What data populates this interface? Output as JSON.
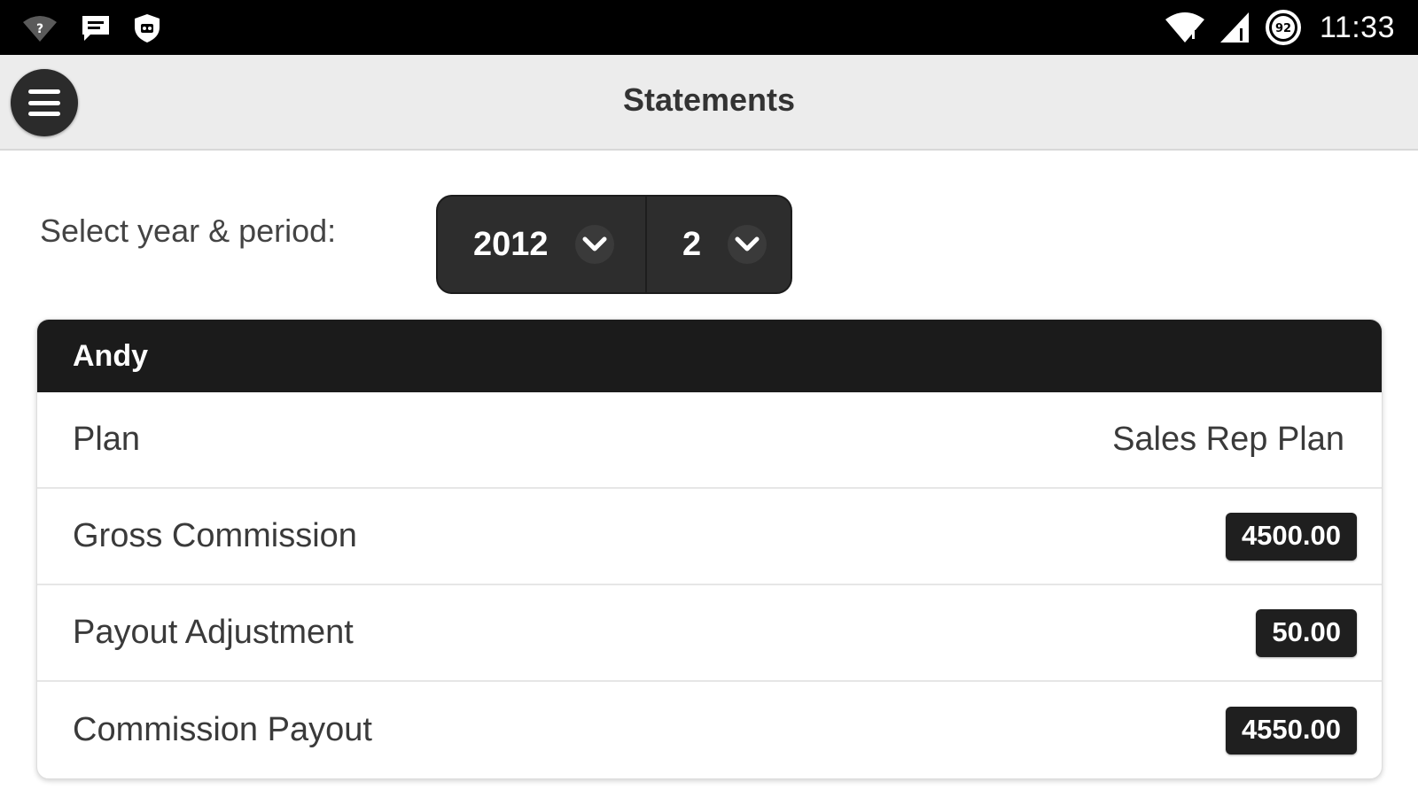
{
  "status_bar": {
    "time": "11:33",
    "left_icons": [
      "wifi-question-icon",
      "message-icon",
      "shield-icon"
    ],
    "right_icons": [
      "wifi-icon",
      "cell-signal-icon",
      "battery-icon"
    ],
    "battery_level": "92"
  },
  "header": {
    "title": "Statements",
    "menu_icon": "hamburger-menu-icon"
  },
  "selector": {
    "label": "Select year & period:",
    "year": "2012",
    "period": "2"
  },
  "statement": {
    "name": "Andy",
    "rows": [
      {
        "label": "Plan",
        "value": "Sales Rep Plan"
      },
      {
        "label": "Gross Commission",
        "value": "4500.00"
      },
      {
        "label": "Payout Adjustment",
        "value": "50.00"
      },
      {
        "label": "Commission Payout",
        "value": "4550.00"
      }
    ]
  },
  "colors": {
    "status_bar_bg": "#000000",
    "header_bg": "#ececec",
    "card_header_bg": "#1b1b1b",
    "badge_bg": "#1f1f1f",
    "select_bg": "#2d2d2d"
  }
}
